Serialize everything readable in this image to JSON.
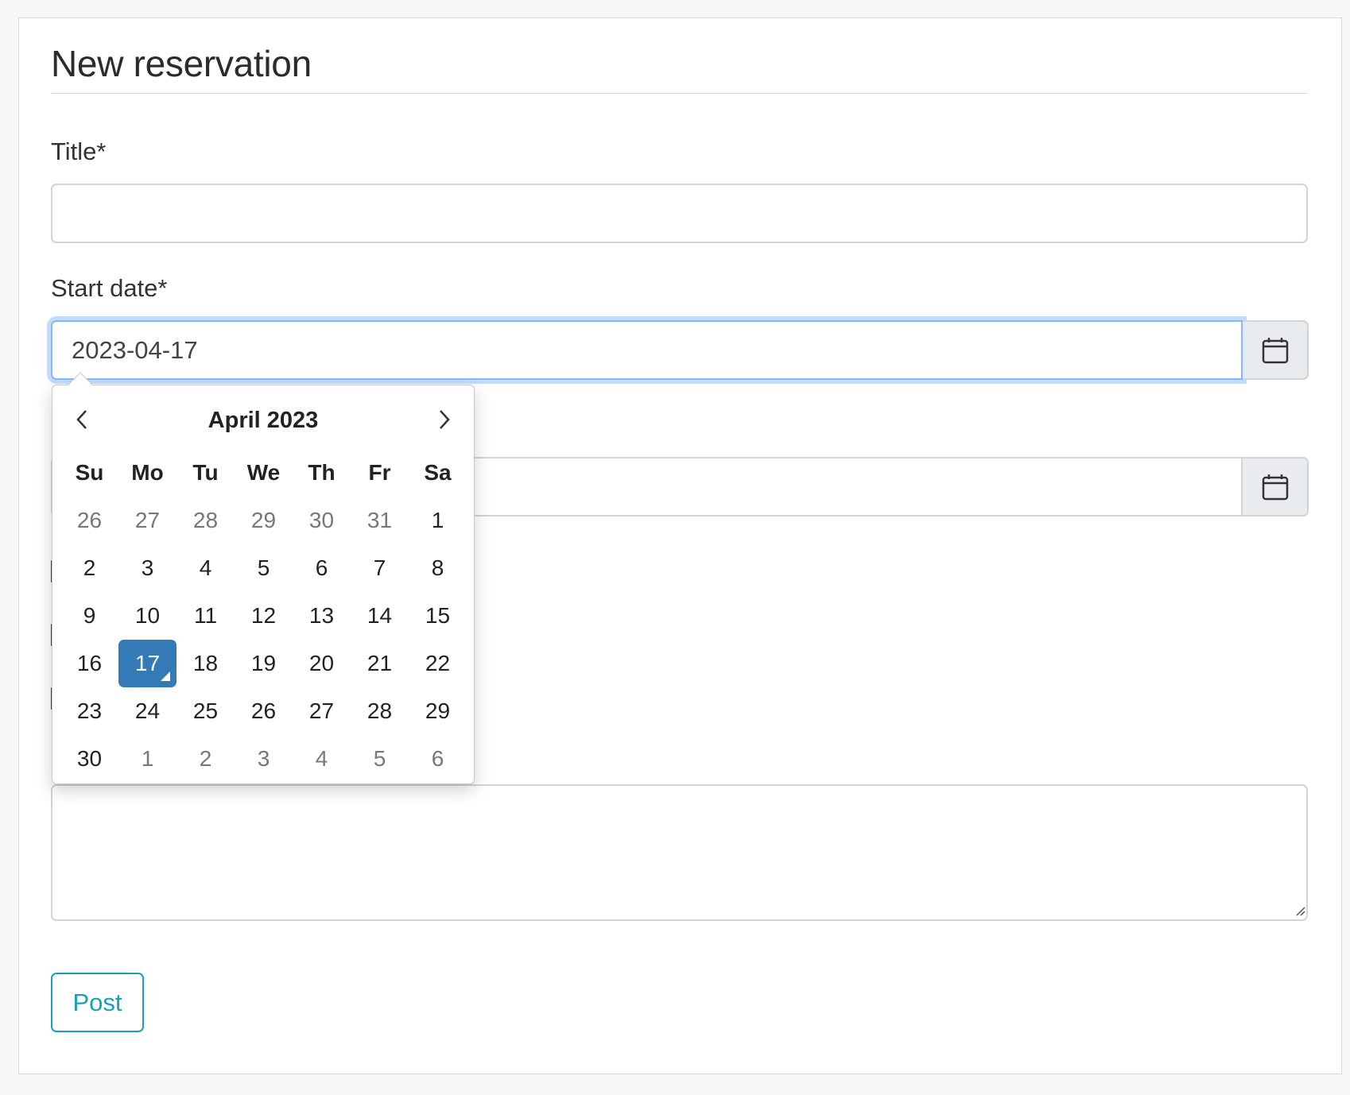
{
  "form": {
    "heading": "New reservation",
    "title_label": "Title*",
    "title_value": "",
    "start_date_label": "Start date*",
    "start_date_value": "2023-04-17",
    "end_date_value": "",
    "notes_value": "",
    "submit_label": "Post"
  },
  "datepicker": {
    "month_label": "April 2023",
    "prev_icon": "chevron-left-icon",
    "next_icon": "chevron-right-icon",
    "weekdays": [
      "Su",
      "Mo",
      "Tu",
      "We",
      "Th",
      "Fr",
      "Sa"
    ],
    "days": [
      {
        "label": "26",
        "muted": true
      },
      {
        "label": "27",
        "muted": true
      },
      {
        "label": "28",
        "muted": true
      },
      {
        "label": "29",
        "muted": true
      },
      {
        "label": "30",
        "muted": true
      },
      {
        "label": "31",
        "muted": true
      },
      {
        "label": "1",
        "muted": false
      },
      {
        "label": "2",
        "muted": false
      },
      {
        "label": "3",
        "muted": false
      },
      {
        "label": "4",
        "muted": false
      },
      {
        "label": "5",
        "muted": false
      },
      {
        "label": "6",
        "muted": false
      },
      {
        "label": "7",
        "muted": false
      },
      {
        "label": "8",
        "muted": false
      },
      {
        "label": "9",
        "muted": false
      },
      {
        "label": "10",
        "muted": false
      },
      {
        "label": "11",
        "muted": false
      },
      {
        "label": "12",
        "muted": false
      },
      {
        "label": "13",
        "muted": false
      },
      {
        "label": "14",
        "muted": false
      },
      {
        "label": "15",
        "muted": false
      },
      {
        "label": "16",
        "muted": false
      },
      {
        "label": "17",
        "muted": false,
        "selected": true
      },
      {
        "label": "18",
        "muted": false
      },
      {
        "label": "19",
        "muted": false
      },
      {
        "label": "20",
        "muted": false
      },
      {
        "label": "21",
        "muted": false
      },
      {
        "label": "22",
        "muted": false
      },
      {
        "label": "23",
        "muted": false
      },
      {
        "label": "24",
        "muted": false
      },
      {
        "label": "25",
        "muted": false
      },
      {
        "label": "26",
        "muted": false
      },
      {
        "label": "27",
        "muted": false
      },
      {
        "label": "28",
        "muted": false
      },
      {
        "label": "29",
        "muted": false
      },
      {
        "label": "30",
        "muted": false
      },
      {
        "label": "1",
        "muted": true
      },
      {
        "label": "2",
        "muted": true
      },
      {
        "label": "3",
        "muted": true
      },
      {
        "label": "4",
        "muted": true
      },
      {
        "label": "5",
        "muted": true
      },
      {
        "label": "6",
        "muted": true
      }
    ]
  },
  "icons": {
    "calendar": "calendar-icon"
  },
  "colors": {
    "accent_selected": "#337ab7",
    "submit_button": "#17a2b8",
    "focus_ring": "#86b7fe"
  }
}
